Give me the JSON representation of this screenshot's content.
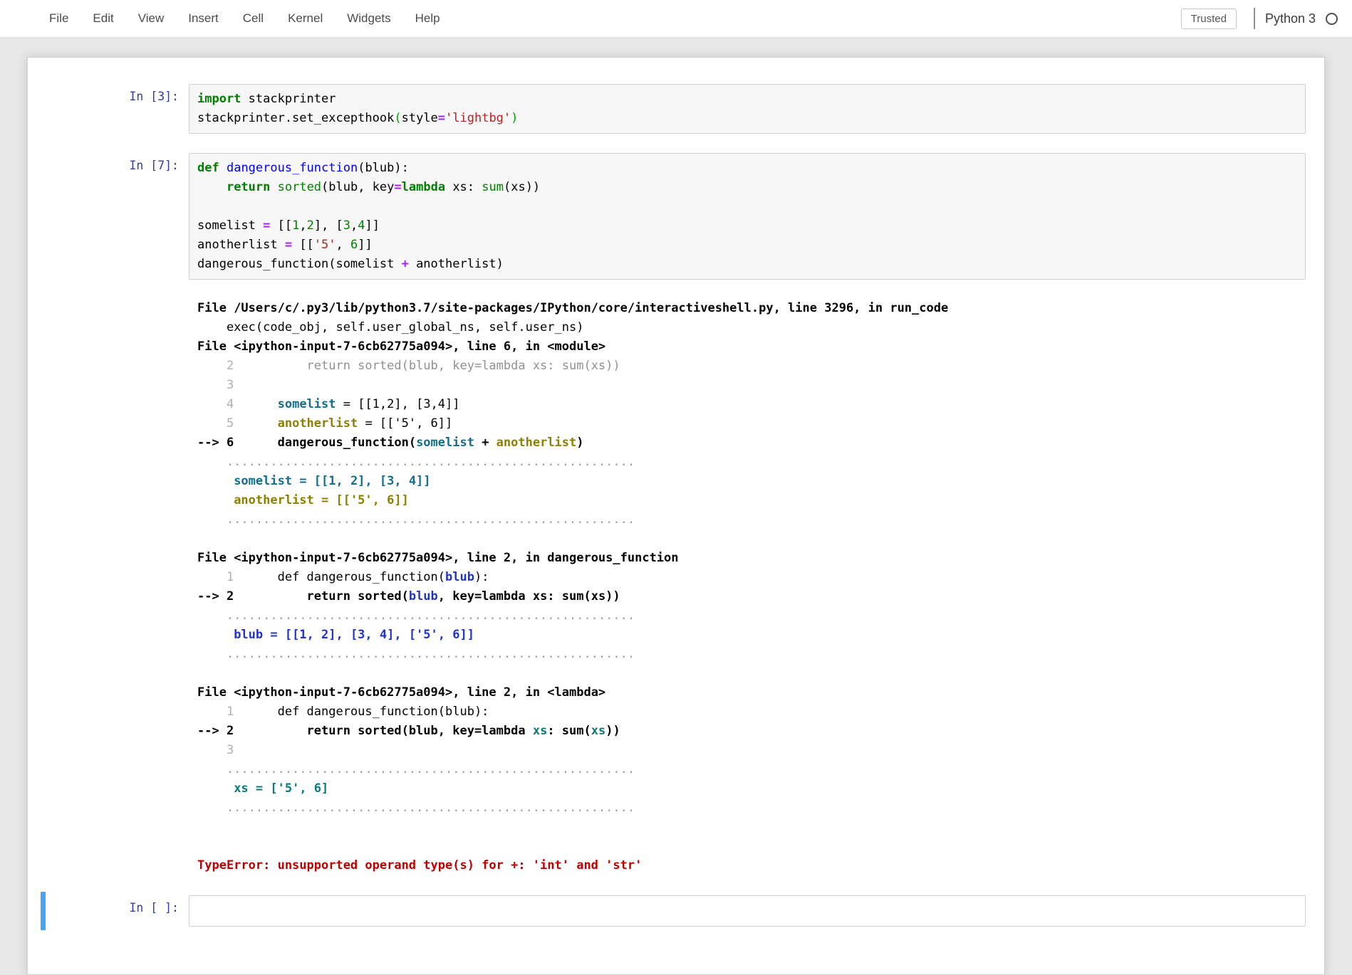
{
  "menu": {
    "items": [
      {
        "label": "File"
      },
      {
        "label": "Edit"
      },
      {
        "label": "View"
      },
      {
        "label": "Insert"
      },
      {
        "label": "Cell"
      },
      {
        "label": "Kernel"
      },
      {
        "label": "Widgets"
      },
      {
        "label": "Help"
      }
    ],
    "trusted_label": "Trusted",
    "kernel_name": "Python 3",
    "kernel_status": "idle"
  },
  "colors": {
    "prompt_blue": "#303f9f",
    "selected_cell": "#42a5f5",
    "keyword_green": "#008000",
    "builtin_green": "#008000",
    "number_green": "#008000",
    "string_red": "#ba2121",
    "operator_purple": "#aa22ff",
    "def_blue": "#0000ff",
    "var_teal": "#136d8c",
    "var_olive": "#8b8000",
    "var_blue": "#2233cc",
    "var_cyan": "#0b7a75",
    "error_red": "#c00000"
  },
  "cells": [
    {
      "prompt": "In [3]:",
      "lines": [
        [
          {
            "t": "import",
            "c": "k"
          },
          {
            "t": " stackprinter",
            "c": "p"
          }
        ],
        [
          {
            "t": "stackprinter.set_excepthook",
            "c": "p"
          },
          {
            "t": "(",
            "c": "mb"
          },
          {
            "t": "style",
            "c": "p"
          },
          {
            "t": "=",
            "c": "o"
          },
          {
            "t": "'lightbg'",
            "c": "s"
          },
          {
            "t": ")",
            "c": "mb"
          }
        ]
      ]
    },
    {
      "prompt": "In [7]:",
      "lines": [
        [
          {
            "t": "def",
            "c": "k"
          },
          {
            "t": " ",
            "c": "p"
          },
          {
            "t": "dangerous_function",
            "c": "d"
          },
          {
            "t": "(blub):",
            "c": "p"
          }
        ],
        [
          {
            "t": "    ",
            "c": "p"
          },
          {
            "t": "return",
            "c": "k"
          },
          {
            "t": " ",
            "c": "p"
          },
          {
            "t": "sorted",
            "c": "b"
          },
          {
            "t": "(blub, key",
            "c": "p"
          },
          {
            "t": "=",
            "c": "o"
          },
          {
            "t": "lambda",
            "c": "k"
          },
          {
            "t": " xs: ",
            "c": "p"
          },
          {
            "t": "sum",
            "c": "b"
          },
          {
            "t": "(xs))",
            "c": "p"
          }
        ],
        [],
        [
          {
            "t": "somelist ",
            "c": "p"
          },
          {
            "t": "=",
            "c": "o"
          },
          {
            "t": " [[",
            "c": "p"
          },
          {
            "t": "1",
            "c": "n"
          },
          {
            "t": ",",
            "c": "p"
          },
          {
            "t": "2",
            "c": "n"
          },
          {
            "t": "], [",
            "c": "p"
          },
          {
            "t": "3",
            "c": "n"
          },
          {
            "t": ",",
            "c": "p"
          },
          {
            "t": "4",
            "c": "n"
          },
          {
            "t": "]]",
            "c": "p"
          }
        ],
        [
          {
            "t": "anotherlist ",
            "c": "p"
          },
          {
            "t": "=",
            "c": "o"
          },
          {
            "t": " [[",
            "c": "p"
          },
          {
            "t": "'5'",
            "c": "s"
          },
          {
            "t": ", ",
            "c": "p"
          },
          {
            "t": "6",
            "c": "n"
          },
          {
            "t": "]]",
            "c": "p"
          }
        ],
        [
          {
            "t": "dangerous_function(somelist ",
            "c": "p"
          },
          {
            "t": "+",
            "c": "o"
          },
          {
            "t": " anotherlist)",
            "c": "p"
          }
        ]
      ]
    }
  ],
  "output_lines": [
    [
      {
        "t": "File ",
        "c": "bd"
      },
      {
        "t": "/Users/c/.py3/lib/python3.7/site-packages/IPython/core/",
        "c": "bd"
      },
      {
        "t": "interactiveshell.py",
        "c": "bd"
      },
      {
        "t": ", line 3296, in run_code",
        "c": "bd"
      }
    ],
    [
      {
        "t": "    exec(code_obj, self.user_global_ns, self.user_ns)",
        "c": "p"
      }
    ],
    [
      {
        "t": "File ",
        "c": "bd"
      },
      {
        "t": "<ipython-input-7-6cb62775a094>",
        "c": "bd"
      },
      {
        "t": ", line 6, in <module>",
        "c": "bd"
      }
    ],
    [
      {
        "t": "    2",
        "c": "ln"
      },
      {
        "t": "          return sorted(blub, key=lambda xs: sum(xs))",
        "c": "gr"
      }
    ],
    [
      {
        "t": "    3",
        "c": "ln"
      }
    ],
    [
      {
        "t": "    4",
        "c": "ln"
      },
      {
        "t": "      ",
        "c": "p"
      },
      {
        "t": "somelist",
        "c": "v1"
      },
      {
        "t": " = [[1,2], [3,4]]",
        "c": "p"
      }
    ],
    [
      {
        "t": "    5",
        "c": "ln"
      },
      {
        "t": "      ",
        "c": "p"
      },
      {
        "t": "anotherlist",
        "c": "v2"
      },
      {
        "t": " = [['5', 6]]",
        "c": "p"
      }
    ],
    [
      {
        "t": "--> 6",
        "c": "ar"
      },
      {
        "t": "      dangerous_function(",
        "c": "bd"
      },
      {
        "t": "somelist",
        "c": "v1"
      },
      {
        "t": " + ",
        "c": "bd"
      },
      {
        "t": "anotherlist",
        "c": "v2"
      },
      {
        "t": ")",
        "c": "bd"
      }
    ],
    [
      {
        "t": "    ........................................................",
        "c": "dot"
      }
    ],
    [
      {
        "t": "     ",
        "c": "p"
      },
      {
        "t": "somelist = [[1, 2], [3, 4]]",
        "c": "v1"
      }
    ],
    [
      {
        "t": "     ",
        "c": "p"
      },
      {
        "t": "anotherlist = [['5', 6]]",
        "c": "v2"
      }
    ],
    [
      {
        "t": "    ........................................................",
        "c": "dot"
      }
    ],
    [],
    [
      {
        "t": "File ",
        "c": "bd"
      },
      {
        "t": "<ipython-input-7-6cb62775a094>",
        "c": "bd"
      },
      {
        "t": ", line 2, in dangerous_function",
        "c": "bd"
      }
    ],
    [
      {
        "t": "    1",
        "c": "ln"
      },
      {
        "t": "      def dangerous_function(",
        "c": "p"
      },
      {
        "t": "blub",
        "c": "v3"
      },
      {
        "t": "):",
        "c": "p"
      }
    ],
    [
      {
        "t": "--> 2",
        "c": "ar"
      },
      {
        "t": "          return sorted(",
        "c": "bd"
      },
      {
        "t": "blub",
        "c": "v3"
      },
      {
        "t": ", key=lambda xs: sum(xs))",
        "c": "bd"
      }
    ],
    [
      {
        "t": "    ........................................................",
        "c": "dot"
      }
    ],
    [
      {
        "t": "     ",
        "c": "p"
      },
      {
        "t": "blub = [[1, 2], [3, 4], ['5', 6]]",
        "c": "v3"
      }
    ],
    [
      {
        "t": "    ........................................................",
        "c": "dot"
      }
    ],
    [],
    [
      {
        "t": "File ",
        "c": "bd"
      },
      {
        "t": "<ipython-input-7-6cb62775a094>",
        "c": "bd"
      },
      {
        "t": ", line 2, in <lambda>",
        "c": "bd"
      }
    ],
    [
      {
        "t": "    1",
        "c": "ln"
      },
      {
        "t": "      def dangerous_function(blub):",
        "c": "p"
      }
    ],
    [
      {
        "t": "--> 2",
        "c": "ar"
      },
      {
        "t": "          return sorted(blub, key=lambda ",
        "c": "bd"
      },
      {
        "t": "xs",
        "c": "v4"
      },
      {
        "t": ": sum(",
        "c": "bd"
      },
      {
        "t": "xs",
        "c": "v4"
      },
      {
        "t": "))",
        "c": "bd"
      }
    ],
    [
      {
        "t": "    3",
        "c": "ln"
      }
    ],
    [
      {
        "t": "    ........................................................",
        "c": "dot"
      }
    ],
    [
      {
        "t": "     ",
        "c": "p"
      },
      {
        "t": "xs = ['5', 6]",
        "c": "v4"
      }
    ],
    [
      {
        "t": "    ........................................................",
        "c": "dot"
      }
    ],
    [],
    [],
    [
      {
        "t": "TypeError: unsupported operand type(s) for +: 'int' and 'str'",
        "c": "err"
      }
    ]
  ],
  "empty_cell": {
    "prompt": "In [ ]:"
  }
}
